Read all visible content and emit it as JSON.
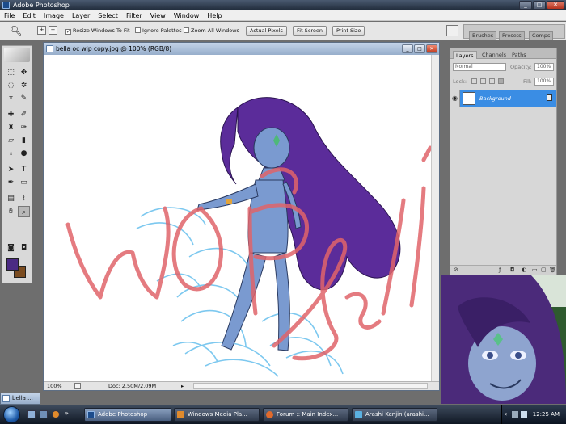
{
  "titlebar": {
    "title": "Adobe Photoshop"
  },
  "menu": [
    "File",
    "Edit",
    "Image",
    "Layer",
    "Select",
    "Filter",
    "View",
    "Window",
    "Help"
  ],
  "options": {
    "resize_label": "Resize Windows To Fit",
    "ignore_label": "Ignore Palettes",
    "zoom_all_label": "Zoom All Windows",
    "actual_pixels": "Actual Pixels",
    "fit_screen": "Fit Screen",
    "print_size": "Print Size"
  },
  "palette_well": {
    "tabs": [
      "Brushes",
      "Presets",
      "Comps"
    ]
  },
  "document": {
    "title": "bella oc wip copy.jpg @ 100% (RGB/8)",
    "zoom": "100%",
    "doc_info": "Doc: 2.50M/2.09M"
  },
  "layers_panel": {
    "tabs": [
      "Layers",
      "Channels",
      "Paths"
    ],
    "blend_mode": "Normal",
    "opacity_label": "Opacity:",
    "opacity_value": "100%",
    "lock_label": "Lock:",
    "fill_label": "Fill:",
    "fill_value": "100%",
    "layer_name": "Background"
  },
  "mini_doc": {
    "label": "bella ..."
  },
  "taskbar": {
    "items": [
      "Adobe Photoshop",
      "Windows Media Pla...",
      "Forum :: Main Index...",
      "Arashi Kenjin (arashi..."
    ],
    "clock": "12:25 AM"
  },
  "colors": {
    "foreground": "#4b2a83",
    "background": "#7b4c20",
    "watermark": "#e0646a",
    "layer_selected": "#3a8de4"
  }
}
